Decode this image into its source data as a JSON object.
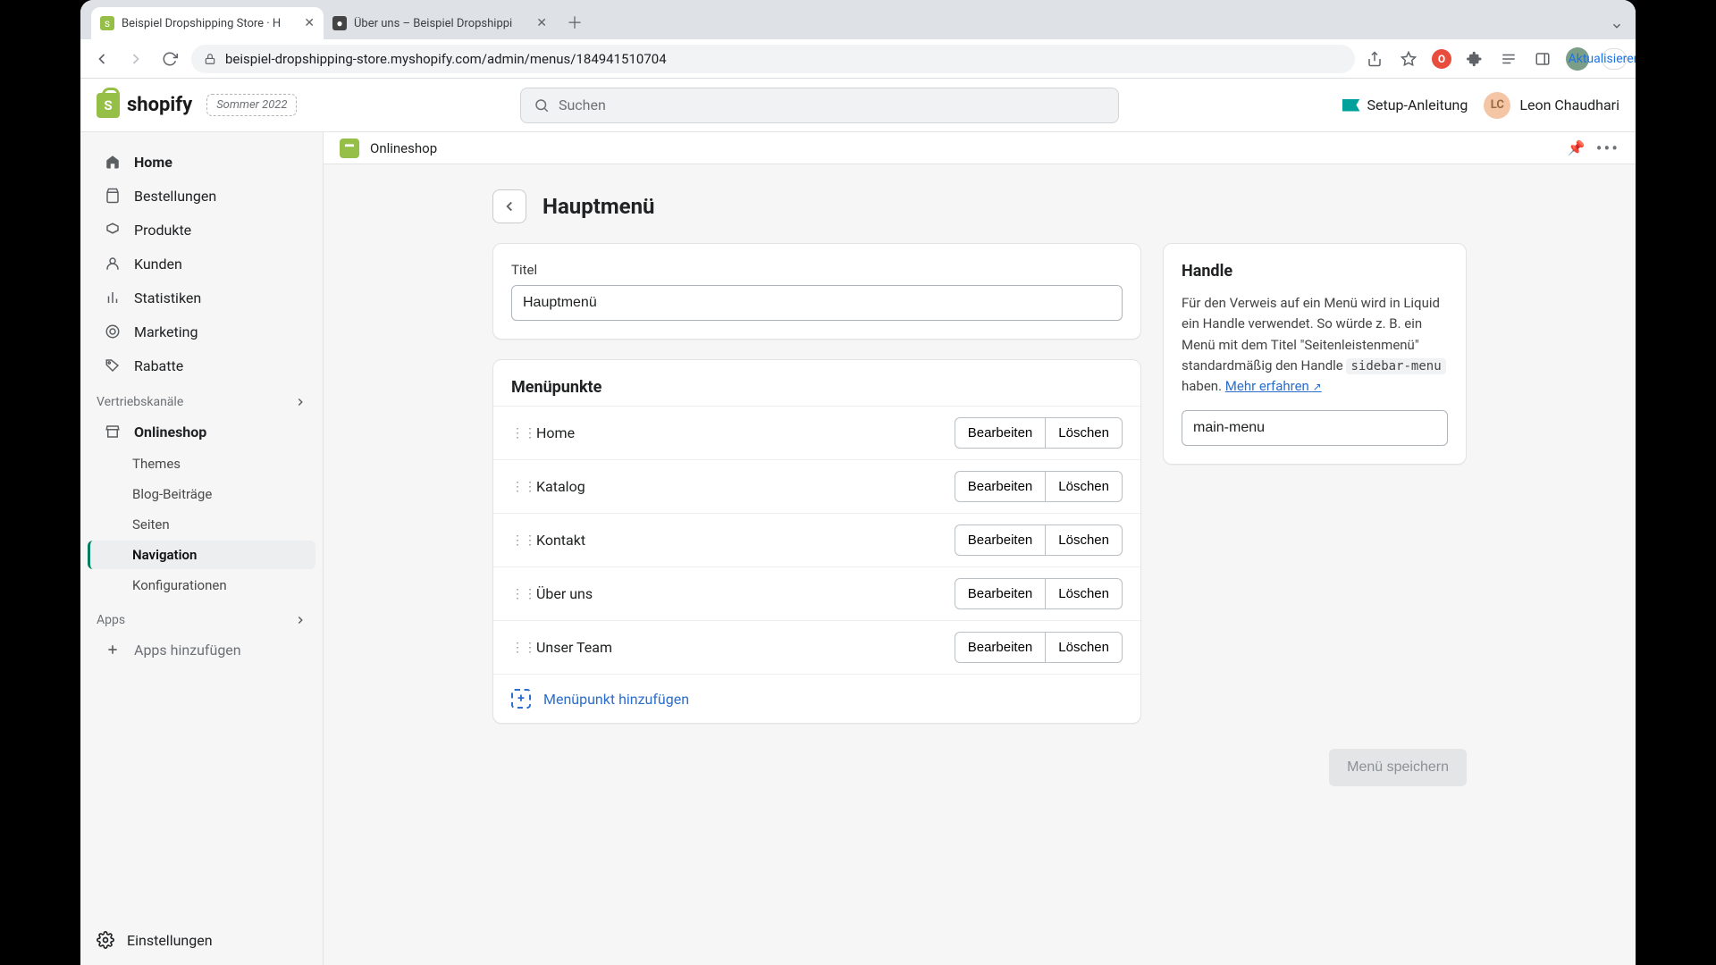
{
  "browser": {
    "tabs": [
      {
        "title": "Beispiel Dropshipping Store · H",
        "favicon_bg": "#95bf47"
      },
      {
        "title": "Über uns – Beispiel Dropshippi",
        "favicon_bg": "#444"
      }
    ],
    "url": "beispiel-dropshipping-store.myshopify.com/admin/menus/184941510704",
    "update_label": "Aktualisieren"
  },
  "topbar": {
    "logo_text": "shopify",
    "season": "Sommer 2022",
    "search_placeholder": "Suchen",
    "setup_label": "Setup-Anleitung",
    "user_initials": "LC",
    "user_name": "Leon Chaudhari"
  },
  "sidebar": {
    "items": [
      {
        "label": "Home",
        "icon": "home-icon"
      },
      {
        "label": "Bestellungen",
        "icon": "orders-icon"
      },
      {
        "label": "Produkte",
        "icon": "products-icon"
      },
      {
        "label": "Kunden",
        "icon": "customers-icon"
      },
      {
        "label": "Statistiken",
        "icon": "analytics-icon"
      },
      {
        "label": "Marketing",
        "icon": "marketing-icon"
      },
      {
        "label": "Rabatte",
        "icon": "discounts-icon"
      }
    ],
    "channels_header": "Vertriebskanäle",
    "channel_label": "Onlineshop",
    "sub_items": [
      {
        "label": "Themes"
      },
      {
        "label": "Blog-Beiträge"
      },
      {
        "label": "Seiten"
      },
      {
        "label": "Navigation"
      },
      {
        "label": "Konfigurationen"
      }
    ],
    "apps_header": "Apps",
    "apps_add": "Apps hinzufügen",
    "settings": "Einstellungen"
  },
  "context": {
    "channel": "Onlineshop"
  },
  "page": {
    "title": "Hauptmenü",
    "title_field_label": "Titel",
    "title_value": "Hauptmenü",
    "menu_points_header": "Menüpunkte",
    "menu_items": [
      {
        "label": "Home"
      },
      {
        "label": "Katalog"
      },
      {
        "label": "Kontakt"
      },
      {
        "label": "Über uns"
      },
      {
        "label": "Unser Team"
      }
    ],
    "edit_label": "Bearbeiten",
    "delete_label": "Löschen",
    "add_label": "Menüpunkt hinzufügen",
    "save_label": "Menü speichern"
  },
  "handle": {
    "header": "Handle",
    "desc_pre": "Für den Verweis auf ein Menü wird in Liquid ein Handle verwendet. So würde z. B. ein Menü mit dem Titel \"Seitenleistenmenü\" standardmäßig den Handle ",
    "desc_code": "sidebar-menu",
    "desc_post": " haben. ",
    "learn_more": "Mehr erfahren",
    "value": "main-menu"
  }
}
